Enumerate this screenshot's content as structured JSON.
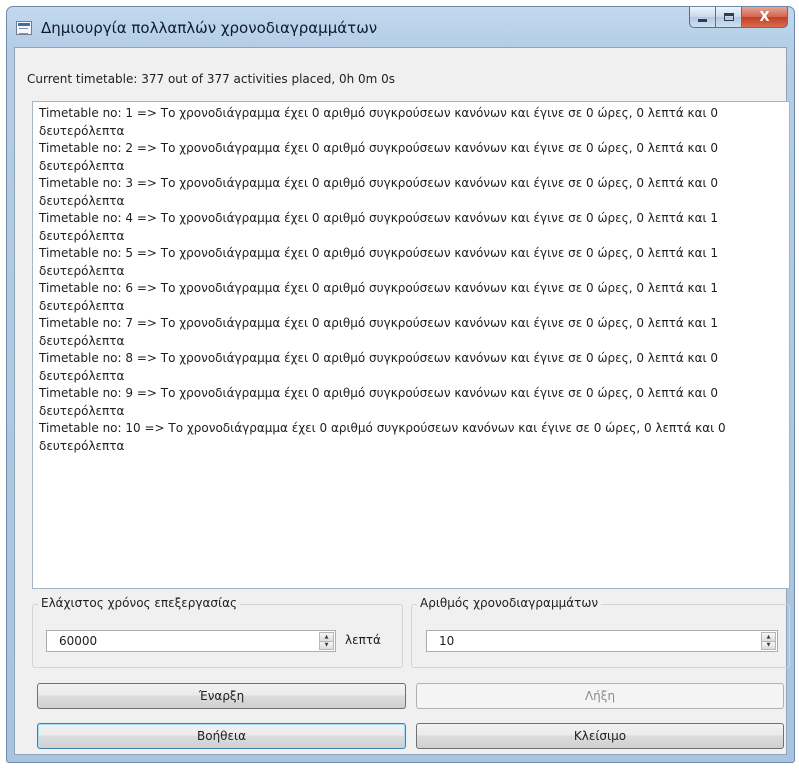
{
  "window": {
    "title": "Δημιουργία πολλαπλών χρονοδιαγραμμάτων",
    "close_glyph": "X"
  },
  "status": {
    "text": "Current timetable: 377 out of 377 activities placed, 0h 0m 0s"
  },
  "log": {
    "lines": [
      "Timetable no: 1 => Το χρονοδιάγραμμα έχει 0 αριθμό συγκρούσεων κανόνων και έγινε σε 0 ώρες, 0 λεπτά και 0 δευτερόλεπτα",
      "Timetable no: 2 => Το χρονοδιάγραμμα έχει 0 αριθμό συγκρούσεων κανόνων και έγινε σε 0 ώρες, 0 λεπτά και 0 δευτερόλεπτα",
      "Timetable no: 3 => Το χρονοδιάγραμμα έχει 0 αριθμό συγκρούσεων κανόνων και έγινε σε 0 ώρες, 0 λεπτά και 0 δευτερόλεπτα",
      "Timetable no: 4 => Το χρονοδιάγραμμα έχει 0 αριθμό συγκρούσεων κανόνων και έγινε σε 0 ώρες, 0 λεπτά και 1 δευτερόλεπτα",
      "Timetable no: 5 => Το χρονοδιάγραμμα έχει 0 αριθμό συγκρούσεων κανόνων και έγινε σε 0 ώρες, 0 λεπτά και 1 δευτερόλεπτα",
      "Timetable no: 6 => Το χρονοδιάγραμμα έχει 0 αριθμό συγκρούσεων κανόνων και έγινε σε 0 ώρες, 0 λεπτά και 1 δευτερόλεπτα",
      "Timetable no: 7 => Το χρονοδιάγραμμα έχει 0 αριθμό συγκρούσεων κανόνων και έγινε σε 0 ώρες, 0 λεπτά και 1 δευτερόλεπτα",
      "Timetable no: 8 => Το χρονοδιάγραμμα έχει 0 αριθμό συγκρούσεων κανόνων και έγινε σε 0 ώρες, 0 λεπτά και 0 δευτερόλεπτα",
      "Timetable no: 9 => Το χρονοδιάγραμμα έχει 0 αριθμό συγκρούσεων κανόνων και έγινε σε 0 ώρες, 0 λεπτά και 0 δευτερόλεπτα",
      "Timetable no: 10 => Το χρονοδιάγραμμα έχει 0 αριθμό συγκρούσεων κανόνων και έγινε σε 0 ώρες, 0 λεπτά και 0 δευτερόλεπτα"
    ]
  },
  "min_time": {
    "group_label": "Ελάχιστος χρόνος επεξεργασίας",
    "value": "60000",
    "unit": "λεπτά"
  },
  "timetable_count": {
    "group_label": "Αριθμός χρονοδιαγραμμάτων",
    "value": "10"
  },
  "buttons": {
    "start": "Έναρξη",
    "stop": "Λήξη",
    "help": "Βοήθεια",
    "close": "Κλείσιμο"
  },
  "icons": {
    "spin_up": "▲",
    "spin_down": "▼"
  }
}
